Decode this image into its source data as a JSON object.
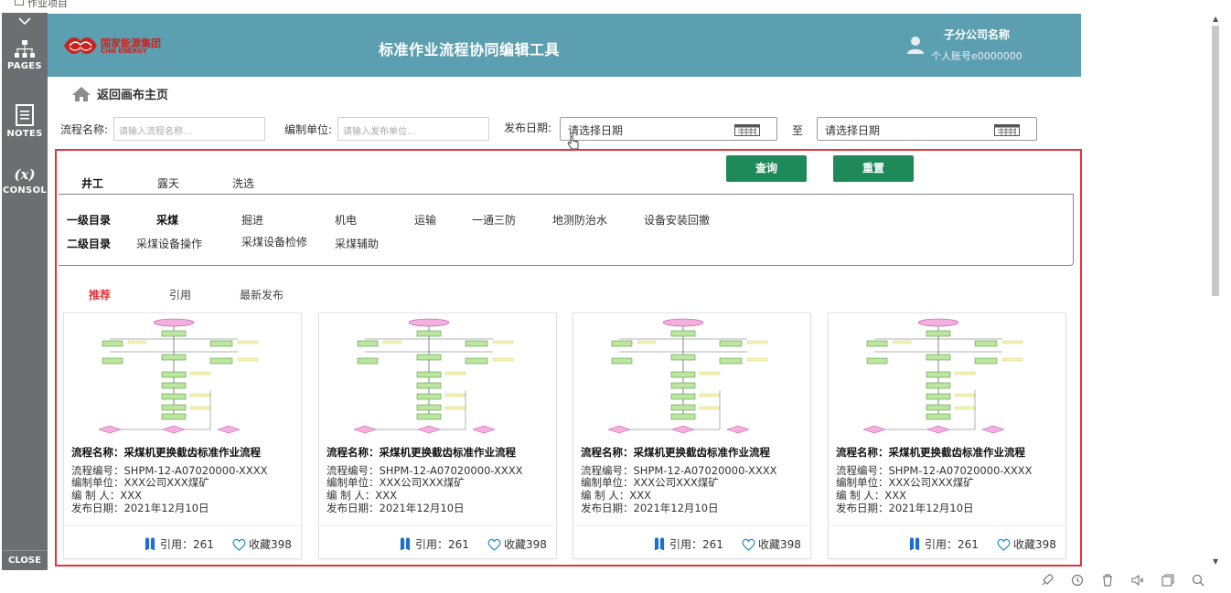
{
  "top_strip": {
    "checkbox_label": "作业项目"
  },
  "rail": {
    "collapse": "﹀",
    "pages": "PAGES",
    "notes": "NOTES",
    "console_symbol": "(x)",
    "console": "CONSOL",
    "close": "CLOSE"
  },
  "header": {
    "logo_cn": "国家能源集团",
    "logo_en": "CHN ENERGY",
    "title": "标准作业流程协同编辑工具",
    "company": "子分公司名称",
    "account": "个人账号e0000000"
  },
  "back_home": "返回画布主页",
  "filters": {
    "name_label": "流程名称:",
    "name_placeholder": "请输入流程名称...",
    "unit_label": "编制单位:",
    "unit_placeholder": "请输入发布单位...",
    "date_label": "发布日期:",
    "date_from": "请选择日期",
    "to": "至",
    "date_to": "请选择日期"
  },
  "main_tabs": [
    "井工",
    "露天",
    "洗选"
  ],
  "buttons": {
    "query": "查询",
    "reset": "重置"
  },
  "categories": {
    "level1_label": "一级目录",
    "level1": [
      "采煤",
      "掘进",
      "机电",
      "运输",
      "一通三防",
      "地测防治水",
      "设备安装回撤"
    ],
    "level2_label": "二级目录",
    "level2": [
      "采煤设备操作",
      "采煤设备检修",
      "采煤辅助"
    ]
  },
  "sort_tabs": [
    "推荐",
    "引用",
    "最新发布"
  ],
  "cards": [
    {
      "title": "流程名称：采煤机更换截齿标准作业流程",
      "code": "流程编号：SHPM-12-A07020000-XXXX",
      "unit": "编制单位：XXX公司XXX煤矿",
      "author": "编 制 人：XXX",
      "date": "发布日期：2021年12月10日",
      "refs": "引用：261",
      "favs": "收藏398"
    },
    {
      "title": "流程名称：采煤机更换截齿标准作业流程",
      "code": "流程编号：SHPM-12-A07020000-XXXX",
      "unit": "编制单位：XXX公司XXX煤矿",
      "author": "编 制 人：XXX",
      "date": "发布日期：2021年12月10日",
      "refs": "引用：261",
      "favs": "收藏398"
    },
    {
      "title": "流程名称：采煤机更换截齿标准作业流程",
      "code": "流程编号：SHPM-12-A07020000-XXXX",
      "unit": "编制单位：XXX公司XXX煤矿",
      "author": "编 制 人：XXX",
      "date": "发布日期：2021年12月10日",
      "refs": "引用：261",
      "favs": "收藏398"
    },
    {
      "title": "流程名称：采煤机更换截齿标准作业流程",
      "code": "流程编号：SHPM-12-A07020000-XXXX",
      "unit": "编制单位：XXX公司XXX煤矿",
      "author": "编 制 人：XXX",
      "date": "发布日期：2021年12月10日",
      "refs": "引用：261",
      "favs": "收藏398"
    }
  ],
  "colors": {
    "header": "#5b9fb0",
    "accent_red": "#e2343a",
    "button_green": "#1e8a5a"
  }
}
